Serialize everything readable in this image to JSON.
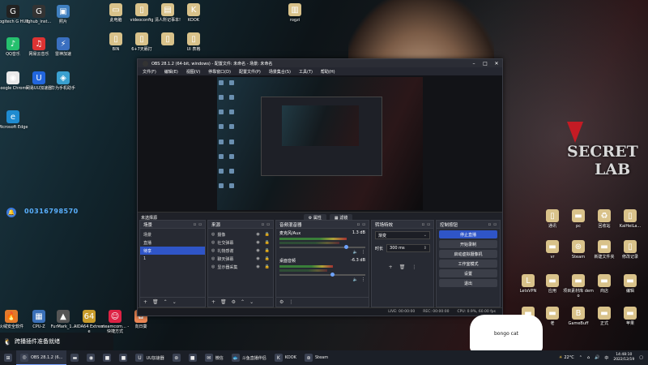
{
  "desktop_icons_left": [
    {
      "label": "Logitech G HUB",
      "icon": "logitech-icon",
      "color": "#222"
    },
    {
      "label": "lghub_inst...",
      "icon": "logitech-installer-icon",
      "color": "#333"
    },
    {
      "label": "照片",
      "icon": "photos-icon",
      "color": "#3f7fbf"
    },
    {
      "label": "QQ音乐",
      "icon": "qqmusic-icon",
      "color": "#26c06e"
    },
    {
      "label": "网易云音乐",
      "icon": "netease-music-icon",
      "color": "#d33"
    },
    {
      "label": "雷神加速",
      "icon": "leishen-icon",
      "color": "#3a6fc0"
    },
    {
      "label": "Google Chrome",
      "icon": "chrome-icon",
      "color": "#e9e9e9"
    },
    {
      "label": "网易UU加速器",
      "icon": "uu-accelerator-icon",
      "color": "#2266dd"
    },
    {
      "label": "华为手机助手",
      "icon": "huawei-assistant-icon",
      "color": "#3aa0d0"
    },
    {
      "label": "Microsoft Edge",
      "icon": "edge-icon",
      "color": "#1f8bd0"
    },
    {
      "label": "火绒安全软件",
      "icon": "huorong-icon",
      "color": "#e27a2b"
    },
    {
      "label": "CPU-Z",
      "icon": "cpuz-icon",
      "color": "#3a70b8"
    },
    {
      "label": "FurMark_1...",
      "icon": "furmark-icon",
      "color": "#555"
    },
    {
      "label": "AIDA64 Extreme",
      "icon": "aida64-icon",
      "color": "#c89b2a"
    },
    {
      "label": "steamcom... - 快捷方式",
      "icon": "steam-shortcut-icon",
      "color": "#d24"
    },
    {
      "label": "向日葵",
      "icon": "sunflower-icon",
      "color": "#e85"
    }
  ],
  "desktop_icons_top": [
    {
      "label": "此电脑",
      "icon": "this-pc-icon"
    },
    {
      "label": "videoconfig",
      "icon": "file-icon"
    },
    {
      "label": "清人所记事本!",
      "icon": "notepad-icon"
    },
    {
      "label": "KOOK",
      "icon": "kook-icon"
    },
    {
      "label": "BIN",
      "icon": "file-icon"
    },
    {
      "label": "6+7天籁打",
      "icon": "file-icon"
    },
    {
      "label": "",
      "icon": "file-icon"
    },
    {
      "label": "UI 表格",
      "icon": "file-icon"
    },
    {
      "label": "rogzi",
      "icon": "zip-icon"
    }
  ],
  "desktop_icons_right": [
    {
      "label": "通讯",
      "icon": "file-icon"
    },
    {
      "label": "pc",
      "icon": "folder-icon"
    },
    {
      "label": "回收站",
      "icon": "recycle-bin-icon"
    },
    {
      "label": "KaiHeiLa...",
      "icon": "file-icon"
    },
    {
      "label": "vr",
      "icon": "folder-icon"
    },
    {
      "label": "Steam",
      "icon": "steam-icon"
    },
    {
      "label": "新建文件夹",
      "icon": "folder-icon"
    },
    {
      "label": "修改记录",
      "icon": "file-icon"
    },
    {
      "label": "LetsVPN",
      "icon": "letsvpn-icon"
    },
    {
      "label": "应用",
      "icon": "folder-icon"
    },
    {
      "label": "项目素材库 demo",
      "icon": "folder-icon"
    },
    {
      "label": "商店",
      "icon": "folder-icon"
    },
    {
      "label": "编辑",
      "icon": "folder-icon"
    },
    {
      "label": "老",
      "icon": "folder-icon"
    },
    {
      "label": "GameBuff",
      "icon": "gamebuff-icon"
    },
    {
      "label": "正式",
      "icon": "folder-icon"
    },
    {
      "label": "苹果",
      "icon": "folder-icon"
    },
    {
      "label": "开播",
      "icon": "folder-icon"
    }
  ],
  "wallpaper": {
    "logo_line1": "SECRET",
    "logo_line2": "LAB"
  },
  "float_widget": {
    "number": "00316798570"
  },
  "obs": {
    "title": "OBS 28.1.2 (64-bit, windows) - 配置文件: 未命名 - 场景: 未命名",
    "menu": [
      "文件(F)",
      "编辑(E)",
      "视图(V)",
      "停靠窗口(D)",
      "配置文件(P)",
      "场景集合(S)",
      "工具(T)",
      "帮助(H)"
    ],
    "no_source": "未选择源",
    "tab_properties": "属性",
    "tab_filters": "滤镜",
    "scenes": {
      "title": "场景",
      "items": [
        "场景",
        "直播",
        "待享",
        "1"
      ],
      "active_index": 2
    },
    "sources": {
      "title": "来源",
      "items": [
        "摄像",
        "社交弹幕",
        "礼物感谢",
        "聊天弹幕",
        "显示器采集"
      ]
    },
    "mixer": {
      "title": "音频混音器",
      "channels": [
        {
          "name": "麦克风/Aux",
          "db": "1.3 dB",
          "level": 0.78
        },
        {
          "name": "桌面音频",
          "db": "-6.3 dB",
          "level": 0.62
        }
      ]
    },
    "transitions": {
      "title": "转场特效",
      "type": "渐变",
      "duration_label": "时长",
      "duration": "300 ms"
    },
    "controls": {
      "title": "控制按钮",
      "buttons": [
        "停止直播",
        "开始录制",
        "启动虚拟摄像机",
        "工作室模式",
        "设置",
        "退出"
      ]
    },
    "status": {
      "live": "LIVE: 00:00:00",
      "rec": "REC: 00:00:00",
      "cpu": "CPU: 0.9%, 60.00 fps"
    }
  },
  "notice": {
    "text": "跨播插件准备就绪"
  },
  "cat_widget": {
    "text": "bongo cat"
  },
  "taskbar": {
    "items": [
      {
        "label": "",
        "icon": "windows-start-icon",
        "active": false
      },
      {
        "label": "OBS 28.1.2 (6...",
        "icon": "obs-icon",
        "active": true
      },
      {
        "label": "",
        "icon": "folder-icon",
        "active": false
      },
      {
        "label": "",
        "icon": "chrome-icon",
        "active": false
      },
      {
        "label": "",
        "icon": "app-icon",
        "active": false
      },
      {
        "label": "",
        "icon": "app-icon",
        "active": false
      },
      {
        "label": "UU加速器",
        "icon": "uu-accelerator-icon",
        "active": false
      },
      {
        "label": "",
        "icon": "steam-icon",
        "active": false
      },
      {
        "label": "",
        "icon": "app-icon",
        "active": false
      },
      {
        "label": "微信",
        "icon": "wechat-icon",
        "active": false
      },
      {
        "label": "斗鱼直播伴侣",
        "icon": "douyu-icon",
        "active": false
      },
      {
        "label": "KOOK",
        "icon": "kook-icon",
        "active": false
      },
      {
        "label": "Steam",
        "icon": "steam-icon",
        "active": false
      }
    ],
    "weather": "22°C",
    "time": "14:48:10",
    "date": "2022/12/19"
  }
}
